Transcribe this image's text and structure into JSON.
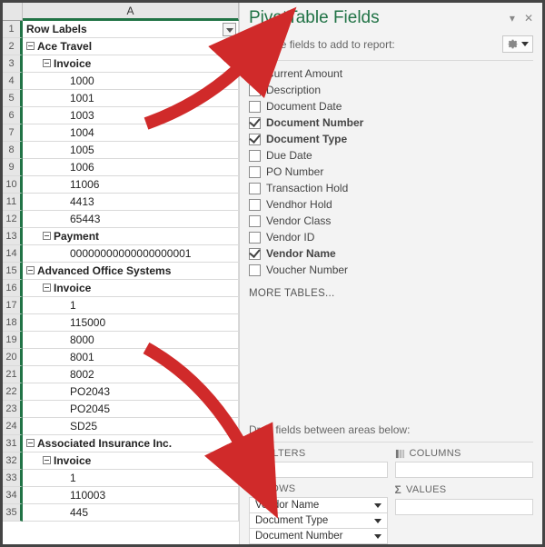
{
  "sheet": {
    "column_letter": "A",
    "row_numbers": [
      1,
      2,
      3,
      4,
      5,
      6,
      7,
      8,
      9,
      10,
      11,
      12,
      13,
      14,
      15,
      16,
      17,
      18,
      19,
      20,
      21,
      22,
      23,
      24,
      31,
      32,
      33,
      34,
      35
    ],
    "rows": [
      {
        "type": "header",
        "text": "Row Labels"
      },
      {
        "type": "group1",
        "text": "Ace Travel"
      },
      {
        "type": "group2",
        "text": "Invoice"
      },
      {
        "type": "item",
        "text": "1000"
      },
      {
        "type": "item",
        "text": "1001"
      },
      {
        "type": "item",
        "text": "1003"
      },
      {
        "type": "item",
        "text": "1004"
      },
      {
        "type": "item",
        "text": "1005"
      },
      {
        "type": "item",
        "text": "1006"
      },
      {
        "type": "item",
        "text": "11006"
      },
      {
        "type": "item",
        "text": "4413"
      },
      {
        "type": "item",
        "text": "65443"
      },
      {
        "type": "group2",
        "text": "Payment"
      },
      {
        "type": "item",
        "text": "00000000000000000001"
      },
      {
        "type": "group1",
        "text": "Advanced Office Systems"
      },
      {
        "type": "group2",
        "text": "Invoice"
      },
      {
        "type": "item",
        "text": "1"
      },
      {
        "type": "item",
        "text": "115000"
      },
      {
        "type": "item",
        "text": "8000"
      },
      {
        "type": "item",
        "text": "8001"
      },
      {
        "type": "item",
        "text": "8002"
      },
      {
        "type": "item",
        "text": "PO2043"
      },
      {
        "type": "item",
        "text": "PO2045"
      },
      {
        "type": "item",
        "text": "SD25"
      },
      {
        "type": "group1",
        "text": "Associated Insurance Inc."
      },
      {
        "type": "group2",
        "text": "Invoice"
      },
      {
        "type": "item",
        "text": "1"
      },
      {
        "type": "item",
        "text": "110003"
      },
      {
        "type": "item",
        "text": "445"
      }
    ]
  },
  "pane": {
    "title": "PivotTable Fields",
    "choose_label": "Choose fields to add to report:",
    "fields": [
      {
        "label": "Current Amount",
        "checked": false
      },
      {
        "label": "Description",
        "checked": false
      },
      {
        "label": "Document Date",
        "checked": false
      },
      {
        "label": "Document Number",
        "checked": true
      },
      {
        "label": "Document Type",
        "checked": true
      },
      {
        "label": "Due Date",
        "checked": false
      },
      {
        "label": "PO Number",
        "checked": false
      },
      {
        "label": "Transaction Hold",
        "checked": false
      },
      {
        "label": "Vendhor Hold",
        "checked": false
      },
      {
        "label": "Vendor Class",
        "checked": false
      },
      {
        "label": "Vendor ID",
        "checked": false
      },
      {
        "label": "Vendor Name",
        "checked": true
      },
      {
        "label": "Voucher Number",
        "checked": false
      }
    ],
    "more_tables": "MORE TABLES...",
    "drag_label": "Drag fields between areas below:",
    "areas": {
      "filters": {
        "header": "FILTERS",
        "items": []
      },
      "columns": {
        "header": "COLUMNS",
        "items": []
      },
      "rows": {
        "header": "ROWS",
        "items": [
          "Vendor Name",
          "Document Type",
          "Document Number"
        ]
      },
      "values": {
        "header": "VALUES",
        "items": []
      }
    }
  }
}
